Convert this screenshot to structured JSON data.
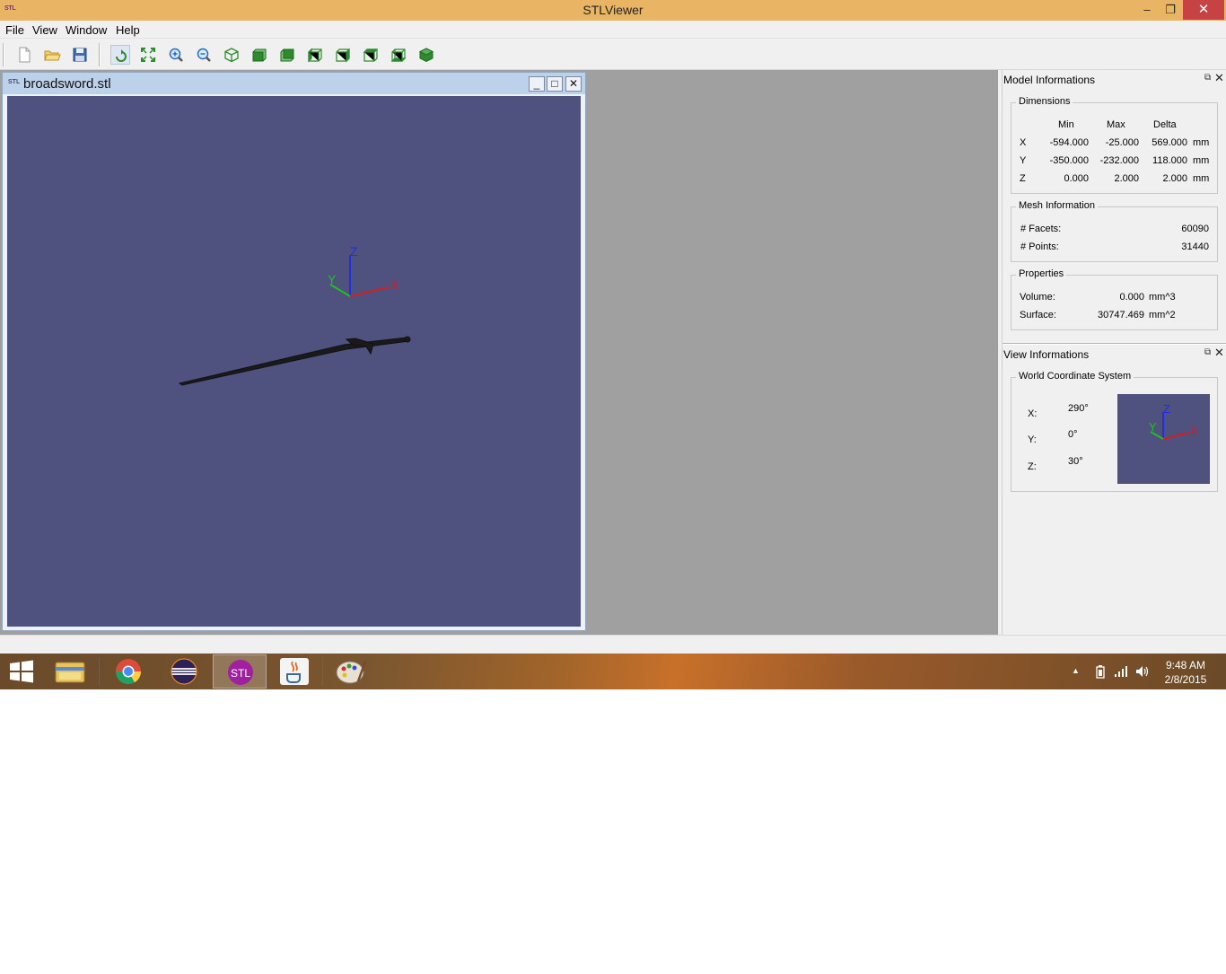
{
  "window": {
    "app_icon_text": "STL",
    "title": "STLViewer",
    "minimize_glyph": "–",
    "maximize_glyph": "❐",
    "close_glyph": "✕"
  },
  "menu": {
    "items": [
      "File",
      "View",
      "Window",
      "Help"
    ]
  },
  "toolbar": {
    "icons": [
      "new-file-icon",
      "open-folder-icon",
      "save-icon",
      "rotate-icon",
      "fit-view-icon",
      "zoom-in-icon",
      "zoom-out-icon",
      "iso-view-icon",
      "front-view-icon",
      "back-view-icon",
      "left-view-icon",
      "right-view-icon",
      "top-view-icon",
      "bottom-view-icon",
      "shaded-view-icon"
    ]
  },
  "document": {
    "icon_text": "STL",
    "title": "broadsword.stl",
    "minimize_glyph": "_",
    "maximize_glyph": "□",
    "close_glyph": "✕",
    "axes": {
      "x": "X",
      "y": "Y",
      "z": "Z"
    },
    "background_color": "#4f517f"
  },
  "model_info": {
    "title": "Model Informations",
    "float_glyph": "⧉",
    "close_glyph": "✕",
    "dimensions": {
      "title": "Dimensions",
      "headers": [
        "Min",
        "Max",
        "Delta"
      ],
      "rows": [
        {
          "axis": "X",
          "min": "-594.000",
          "max": "-25.000",
          "delta": "569.000",
          "unit": "mm"
        },
        {
          "axis": "Y",
          "min": "-350.000",
          "max": "-232.000",
          "delta": "118.000",
          "unit": "mm"
        },
        {
          "axis": "Z",
          "min": "0.000",
          "max": "2.000",
          "delta": "2.000",
          "unit": "mm"
        }
      ]
    },
    "mesh": {
      "title": "Mesh Information",
      "facets_label": "# Facets:",
      "facets_value": "60090",
      "points_label": "# Points:",
      "points_value": "31440"
    },
    "properties": {
      "title": "Properties",
      "volume_label": "Volume:",
      "volume_value": "0.000",
      "volume_unit": "mm^3",
      "surface_label": "Surface:",
      "surface_value": "30747.469",
      "surface_unit": "mm^2"
    }
  },
  "view_info": {
    "title": "View Informations",
    "float_glyph": "⧉",
    "close_glyph": "✕",
    "wcs": {
      "title": "World Coordinate System",
      "x_label": "X:",
      "x_value": "290°",
      "y_label": "Y:",
      "y_value": "0°",
      "z_label": "Z:",
      "z_value": "30°",
      "axes": {
        "x": "X",
        "y": "Y",
        "z": "Z"
      }
    }
  },
  "taskbar": {
    "apps": [
      "file-explorer-icon",
      "chrome-icon",
      "eclipse-icon",
      "stlviewer-icon",
      "java-icon",
      "paint-icon"
    ],
    "stl_app_text": "STL",
    "tray_up_glyph": "▲",
    "time": "9:48 AM",
    "date": "2/8/2015"
  },
  "colors": {
    "titlebar": "#e9b565",
    "close_button": "#c74343",
    "viewport": "#4f517f",
    "axis_x": "#d02020",
    "axis_y": "#20c020",
    "axis_z": "#2030e0"
  }
}
